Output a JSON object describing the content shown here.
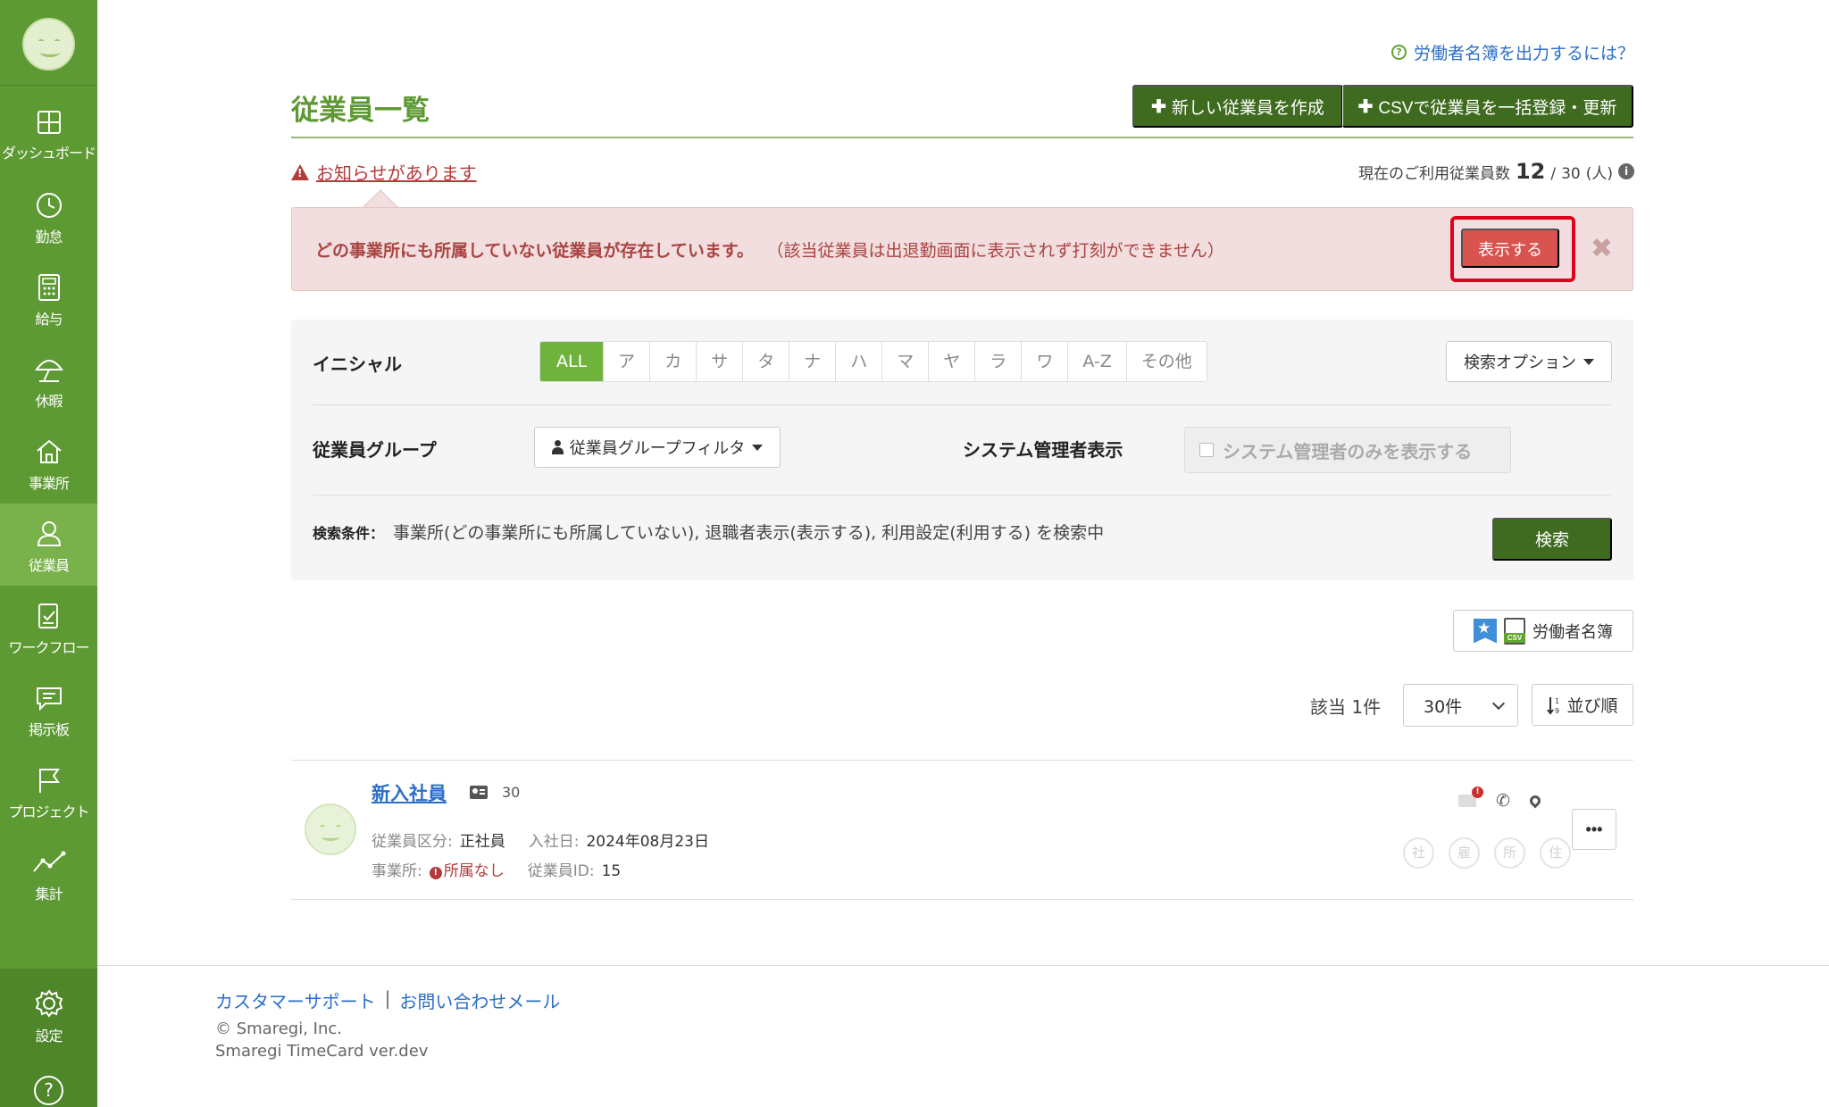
{
  "sidebar": {
    "items": [
      {
        "label": "ダッシュボード",
        "icon": "dashboard-icon"
      },
      {
        "label": "勤怠",
        "icon": "clock-icon"
      },
      {
        "label": "給与",
        "icon": "calculator-icon"
      },
      {
        "label": "休暇",
        "icon": "umbrella-icon"
      },
      {
        "label": "事業所",
        "icon": "home-icon"
      },
      {
        "label": "従業員",
        "icon": "person-icon"
      },
      {
        "label": "ワークフロー",
        "icon": "checklist-icon"
      },
      {
        "label": "掲示板",
        "icon": "chat-icon"
      },
      {
        "label": "プロジェクト",
        "icon": "flag-icon"
      },
      {
        "label": "集計",
        "icon": "chart-icon"
      }
    ],
    "settings_label": "設定",
    "help_label": "?"
  },
  "header": {
    "help_link": "労働者名簿を出力するには？",
    "title": "従業員一覧",
    "new_employee_btn": "新しい従業員を作成",
    "csv_btn": "CSVで従業員を一括登録・更新"
  },
  "notice": {
    "link": "お知らせがあります",
    "usage_prefix": "現在のご利用従業員数",
    "usage_current": "12",
    "usage_sep": "/",
    "usage_max": "30",
    "usage_unit": "(人)"
  },
  "alert": {
    "main": "どの事業所にも所属していない従業員が存在しています。",
    "sub": "（該当従業員は出退勤画面に表示されず打刻ができません）",
    "show_btn": "表示する",
    "close": "✖"
  },
  "filters": {
    "initial_label": "イニシャル",
    "initials": [
      "ALL",
      "ア",
      "カ",
      "サ",
      "タ",
      "ナ",
      "ハ",
      "マ",
      "ヤ",
      "ラ",
      "ワ",
      "A-Z",
      "その他"
    ],
    "search_options": "検索オプション",
    "group_label": "従業員グループ",
    "group_filter": "従業員グループフィルタ",
    "admin_label": "システム管理者表示",
    "admin_check": "システム管理者のみを表示する",
    "cond_label": "検索条件：",
    "cond_text": "事業所(どの事業所にも所属していない), 退職者表示(表示する), 利用設定(利用する) を検索中",
    "search_btn": "検索"
  },
  "roster_btn": "労働者名簿",
  "list": {
    "count_text": "該当 1件",
    "per_page": "30件",
    "sort_btn": "並び順"
  },
  "employee": {
    "name": "新入社員",
    "age": "30",
    "type_label": "従業員区分:",
    "type_value": "正社員",
    "join_label": "入社日:",
    "join_value": "2024年08月23日",
    "office_label": "事業所:",
    "office_value": "所属なし",
    "id_label": "従業員ID:",
    "id_value": "15",
    "circles": [
      "社",
      "雇",
      "所",
      "住"
    ],
    "more": "•••"
  },
  "footer": {
    "support": "カスタマーサポート",
    "mail": "お問い合わせメール",
    "copyright": "© Smaregi, Inc.",
    "version": "Smaregi TimeCard ver.dev"
  }
}
